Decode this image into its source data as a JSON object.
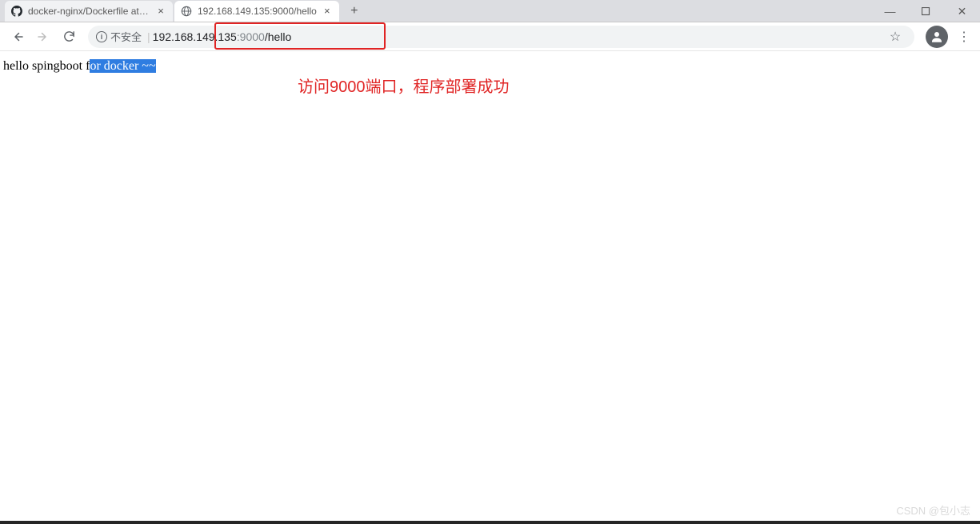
{
  "window": {
    "tabs": [
      {
        "title": "docker-nginx/Dockerfile at fea",
        "favicon": "github"
      },
      {
        "title": "192.168.149.135:9000/hello",
        "favicon": "globe"
      }
    ],
    "controls": {
      "min": "—",
      "max": "□",
      "close": "✕"
    }
  },
  "toolbar": {
    "site_info_label": "不安全",
    "url_host": "192.168.149.135",
    "url_port": ":9000",
    "url_path": "/hello"
  },
  "page": {
    "text_before_cursor": "hello sp",
    "text_after_cursor": "ingboot f",
    "text_selected": "or docker ~~",
    "annotation": "访问9000端口，程序部署成功"
  },
  "watermark": "CSDN @包小志"
}
